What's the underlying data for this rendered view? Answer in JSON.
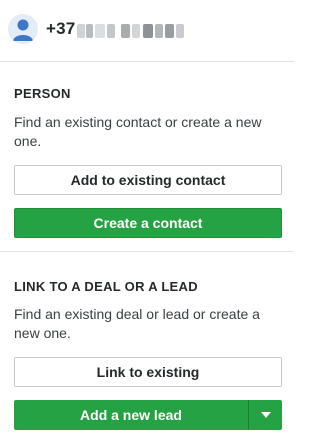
{
  "header": {
    "phone_prefix": "+37",
    "avatar_icon": "person-icon"
  },
  "person_section": {
    "title": "PERSON",
    "description": "Find an existing contact or create a new one.",
    "add_existing_label": "Add to existing contact",
    "create_label": "Create a contact"
  },
  "link_section": {
    "title": "LINK TO A DEAL OR A LEAD",
    "description": "Find an existing deal or lead or create a new one.",
    "link_existing_label": "Link to existing",
    "add_lead_label": "Add a new lead",
    "dropdown_icon": "caret-down-icon"
  },
  "colors": {
    "primary_green": "#25a244",
    "border": "#c7c9cc",
    "divider": "#e0e2e4",
    "avatar_bg": "#e3ecf7",
    "avatar_fg": "#3d78c8"
  }
}
